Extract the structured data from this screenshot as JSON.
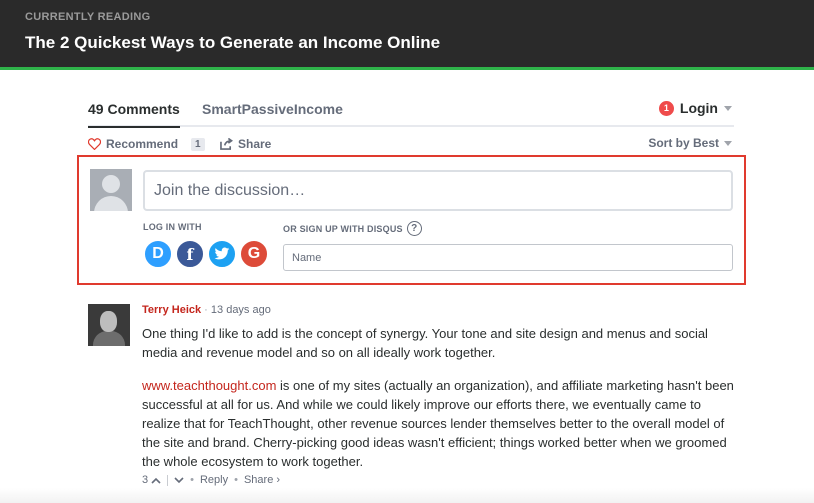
{
  "header": {
    "kicker": "CURRENTLY READING",
    "title": "The 2 Quickest Ways to Generate an Income Online",
    "accent_color": "#2fb34a"
  },
  "tabs": {
    "comments_label": "49 Comments",
    "site_label": "SmartPassiveIncome",
    "login_badge": "1",
    "login_label": "Login"
  },
  "actions": {
    "recommend_label": "Recommend",
    "recommend_count": "1",
    "share_label": "Share",
    "sort_label": "Sort by Best"
  },
  "composer": {
    "placeholder": "Join the discussion…",
    "login_with": "LOG IN WITH",
    "signup_with": "OR SIGN UP WITH DISQUS",
    "help_glyph": "?",
    "name_placeholder": "Name",
    "social": [
      {
        "icon": "disqus-icon",
        "glyph": "D"
      },
      {
        "icon": "facebook-icon",
        "glyph": "f"
      },
      {
        "icon": "twitter-icon",
        "glyph": "🐦"
      },
      {
        "icon": "google-icon",
        "glyph": "G"
      }
    ],
    "highlight_color": "#e03a2e"
  },
  "comment": {
    "author": "Terry Heick",
    "time": "13 days ago",
    "para1": "One thing I'd like to add is the concept of synergy. Your tone and site design and menus and social media and revenue model and so on all ideally work together.",
    "link": "www.teachthought.com",
    "para2_rest": " is one of my sites (actually an organization), and affiliate marketing hasn't been successful at all for us. And while we could likely improve our efforts there, we eventually came to realize that for TeachThought, other revenue sources lender themselves better to the overall model of the site and brand. Cherry-picking good ideas wasn't efficient; things worked better when we groomed the whole ecosystem to work together.",
    "votes": "3",
    "reply_label": "Reply",
    "share_label": "Share ›"
  }
}
